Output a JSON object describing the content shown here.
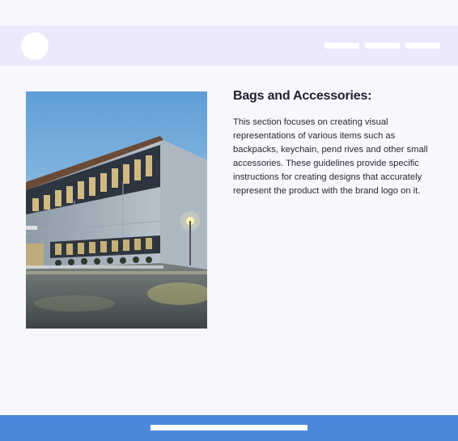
{
  "header": {
    "logo_icon": "circle-logo-icon",
    "nav_items": [
      "nav-placeholder-1",
      "nav-placeholder-2",
      "nav-placeholder-3"
    ]
  },
  "content": {
    "image_icon": "building-photo",
    "title": "Bags and Accessories:",
    "description": "This section focuses on creating visual representations of various items such as backpacks, keychain, pend rives and other small accessories. These guidelines provide specific instructions for creating designs that accurately represent the product with the brand logo on it."
  },
  "footer": {
    "bar_icon": "footer-placeholder-line"
  },
  "colors": {
    "header_bg": "#ede8fc",
    "footer_bg": "#4b88dc",
    "page_bg": "#f7f7fd"
  }
}
